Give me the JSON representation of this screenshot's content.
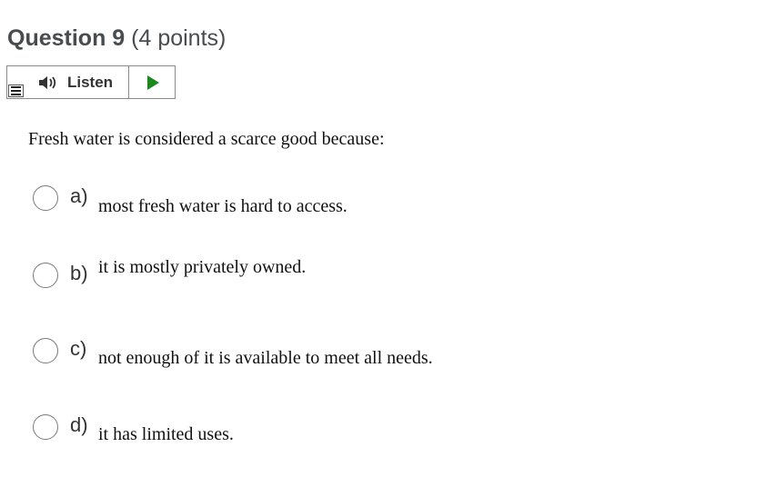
{
  "question": {
    "title": "Question 9",
    "points": "(4 points)"
  },
  "listen_bar": {
    "listen_label": "Listen",
    "menu_icon": "menu-icon",
    "speaker_icon": "speaker-icon",
    "play_icon": "play-icon",
    "play_color": "#1a8a1a"
  },
  "prompt": "Fresh water is considered a scarce good because:",
  "options": [
    {
      "letter": "a)",
      "text": "most fresh water is hard to access."
    },
    {
      "letter": "b)",
      "text": "it is mostly privately owned."
    },
    {
      "letter": "c)",
      "text": "not enough of it is available to meet all needs."
    },
    {
      "letter": "d)",
      "text": "it has limited uses."
    }
  ]
}
